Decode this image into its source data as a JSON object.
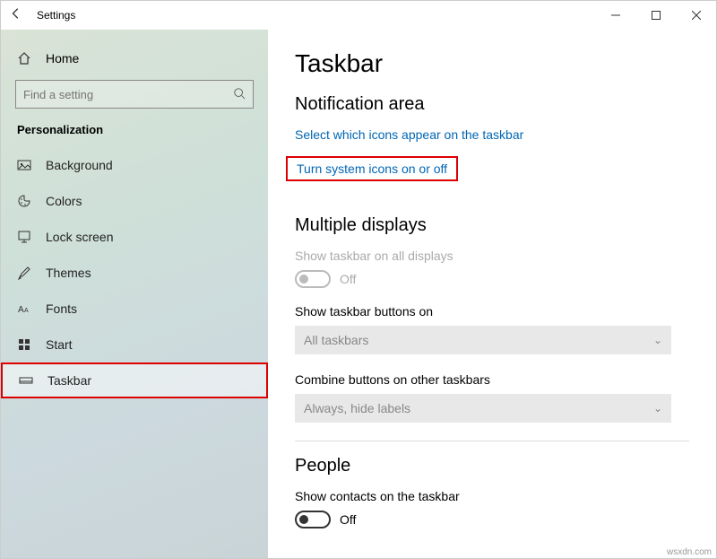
{
  "titlebar": {
    "title": "Settings"
  },
  "sidebar": {
    "home": "Home",
    "search_placeholder": "Find a setting",
    "category": "Personalization",
    "items": [
      {
        "label": "Background"
      },
      {
        "label": "Colors"
      },
      {
        "label": "Lock screen"
      },
      {
        "label": "Themes"
      },
      {
        "label": "Fonts"
      },
      {
        "label": "Start"
      },
      {
        "label": "Taskbar"
      }
    ]
  },
  "main": {
    "title": "Taskbar",
    "notification_heading": "Notification area",
    "link_icons": "Select which icons appear on the taskbar",
    "link_system": "Turn system icons on or off",
    "multiple_heading": "Multiple displays",
    "show_all_label": "Show taskbar on all displays",
    "show_all_state": "Off",
    "show_buttons_label": "Show taskbar buttons on",
    "show_buttons_value": "All taskbars",
    "combine_label": "Combine buttons on other taskbars",
    "combine_value": "Always, hide labels",
    "people_heading": "People",
    "contacts_label": "Show contacts on the taskbar",
    "contacts_state": "Off"
  },
  "watermark": "wsxdn.com"
}
